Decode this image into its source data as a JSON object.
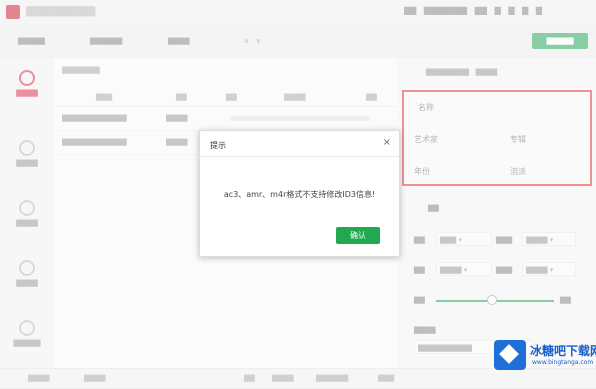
{
  "dialog": {
    "title": "提示",
    "close": "×",
    "message": "ac3、amr、m4r格式不支持修改ID3信息!",
    "ok_label": "确认"
  },
  "settings": {
    "row1": "名称",
    "row2a": "艺术家",
    "row2b": "专辑",
    "row3a": "年份",
    "row3b": "流派"
  },
  "watermark": {
    "brand": "冰糖吧下载网",
    "url": "www.bingtanga.com"
  },
  "colors": {
    "accent_green": "#22a84f",
    "highlight_red": "#e03a3a",
    "brand_red": "#c7242f"
  }
}
